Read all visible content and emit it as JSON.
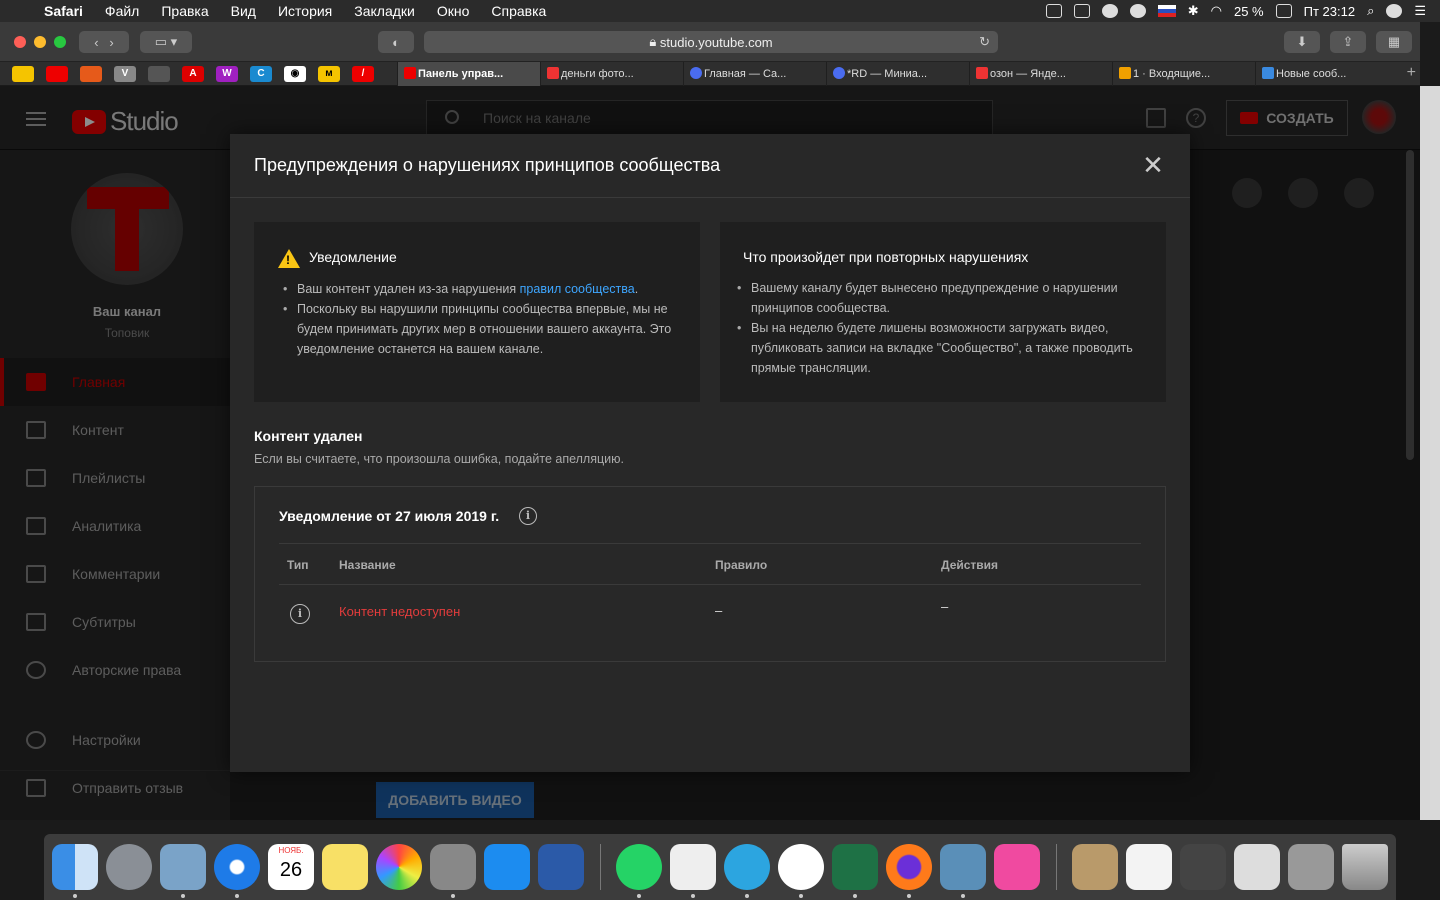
{
  "menubar": {
    "app": "Safari",
    "items": [
      "Файл",
      "Правка",
      "Вид",
      "История",
      "Закладки",
      "Окно",
      "Справка"
    ],
    "battery": "25 %",
    "clock": "Пт 23:12"
  },
  "browser": {
    "url": "studio.youtube.com",
    "tabs": [
      {
        "label": "Панель управ...",
        "active": true,
        "color": "#e00"
      },
      {
        "label": "деньги фото...",
        "active": false,
        "color": "#e33"
      },
      {
        "label": "Главная — Са...",
        "active": false,
        "color": "#4a6cf0"
      },
      {
        "label": "*RD — Миниа...",
        "active": false,
        "color": "#4a6cf0"
      },
      {
        "label": "озон — Янде...",
        "active": false,
        "color": "#e33"
      },
      {
        "label": "1 · Входящие...",
        "active": false,
        "color": "#f0a000"
      },
      {
        "label": "Новые сооб...",
        "active": false,
        "color": "#3a8ae0"
      }
    ],
    "tab_add": "+"
  },
  "studio": {
    "logo_text": "Studio",
    "search_placeholder": "Поиск на канале",
    "create_label": "СОЗДАТЬ",
    "channel_name": "Ваш канал",
    "channel_sub": "Топовик",
    "nav": [
      {
        "label": "Главная",
        "active": true
      },
      {
        "label": "Контент",
        "active": false
      },
      {
        "label": "Плейлисты",
        "active": false
      },
      {
        "label": "Аналитика",
        "active": false
      },
      {
        "label": "Комментарии",
        "active": false
      },
      {
        "label": "Субтитры",
        "active": false
      },
      {
        "label": "Авторские права",
        "active": false
      }
    ],
    "settings_label": "Настройки",
    "feedback_label": "Отправить отзыв",
    "add_video_label": "ДОБАВИТЬ ВИДЕО"
  },
  "modal": {
    "title": "Предупреждения о нарушениях принципов сообщества",
    "close": "✕",
    "notice_card": {
      "heading": "Уведомление",
      "bullet1_prefix": "Ваш контент удален из-за нарушения ",
      "bullet1_link": "правил сообщества",
      "bullet1_suffix": ".",
      "bullet2": "Поскольку вы нарушили принципы сообщества впервые, мы не будем принимать других мер в отношении вашего аккаунта. Это уведомление останется на вашем канале."
    },
    "repeat_card": {
      "heading": "Что произойдет при повторных нарушениях",
      "bullet1": "Вашему каналу будет вынесено предупреждение о нарушении принципов сообщества.",
      "bullet2": "Вы на неделю будете лишены возможности загружать видео, публиковать записи на вкладке \"Сообщество\", а также проводить прямые трансляции."
    },
    "removed_title": "Контент удален",
    "removed_sub": "Если вы считаете, что произошла ошибка, подайте апелляцию.",
    "notice_date_title": "Уведомление от 27 июля 2019 г.",
    "table": {
      "headers": {
        "type": "Тип",
        "name": "Название",
        "rule": "Правило",
        "actions": "Действия"
      },
      "row": {
        "name": "Контент недоступен",
        "rule": "–",
        "actions": "–"
      }
    }
  },
  "dock": {
    "calendar_month": "НОЯБ.",
    "calendar_day": "26"
  },
  "colors": {
    "accent_red": "#cc0000",
    "link_blue": "#3ea6ff",
    "warning_yellow": "#f9c514"
  }
}
